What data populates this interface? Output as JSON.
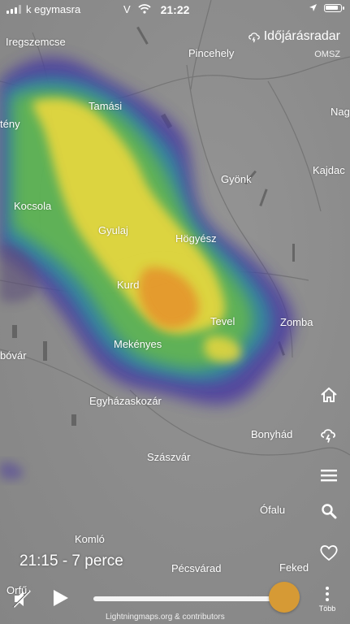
{
  "status_bar": {
    "carrier": "k egymasra",
    "vpn": "V",
    "time": "21:22"
  },
  "brand": {
    "name": "Időjárásradar",
    "source": "OMSZ"
  },
  "places": [
    {
      "name": "Iregszemcse"
    },
    {
      "name": "Pincehely"
    },
    {
      "name": "Tamási"
    },
    {
      "name": "tény"
    },
    {
      "name": "Nag"
    },
    {
      "name": "Gyönk"
    },
    {
      "name": "Kajdac"
    },
    {
      "name": "Kocsola"
    },
    {
      "name": "Gyulaj"
    },
    {
      "name": "Högyész"
    },
    {
      "name": "Kurd"
    },
    {
      "name": "Tevel"
    },
    {
      "name": "Zomba"
    },
    {
      "name": "Mekényes"
    },
    {
      "name": "bóvár"
    },
    {
      "name": "Egyházaskozár"
    },
    {
      "name": "Bonyhád"
    },
    {
      "name": "Szászvár"
    },
    {
      "name": "Ófalu"
    },
    {
      "name": "Komló"
    },
    {
      "name": "Pécsvárad"
    },
    {
      "name": "Feked"
    },
    {
      "name": "Orfű"
    }
  ],
  "side_tools": [
    {
      "icon": "home-icon"
    },
    {
      "icon": "storm-cloud-icon"
    },
    {
      "icon": "menu-icon"
    },
    {
      "icon": "search-icon"
    },
    {
      "icon": "heart-icon"
    }
  ],
  "playback": {
    "time_label": "21:15 - 7 perce",
    "progress": 1.0,
    "attribution": "Lightningmaps.org & contributors",
    "more_label": "Több"
  },
  "colors": {
    "accent": "#d69a35",
    "radar_high": "#e5912b",
    "radar_mid": "#e9d73d",
    "radar_low": "#63b64f",
    "radar_edge": "#4b3aa0"
  }
}
